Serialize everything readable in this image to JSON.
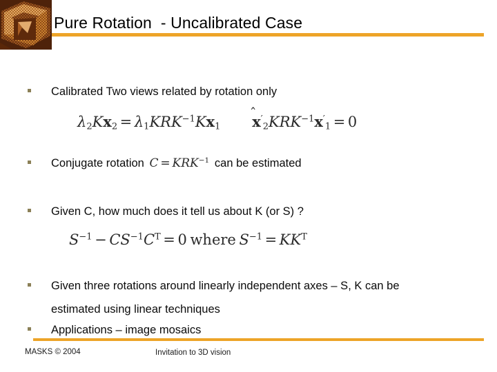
{
  "slide": {
    "title": "Pure Rotation  - Uncalibrated Case",
    "accent_color": "#eda428",
    "bullet_color": "#8b8057",
    "background_color": "#ffffff"
  },
  "logo": {
    "name": "masks-cube-logo",
    "colors": [
      "#7a3b12",
      "#c87a30",
      "#e8b273",
      "#5c2a0c",
      "#a85c20"
    ]
  },
  "bullets": [
    {
      "id": "b1",
      "text": "Calibrated Two views related by rotation only"
    },
    {
      "id": "b2",
      "text_before": "Conjugate rotation",
      "text_after": "can be estimated"
    },
    {
      "id": "b3",
      "text": "Given C, how much does it tell us about K (or S) ?"
    },
    {
      "id": "b4",
      "text": "Given three rotations around linearly independent  axes – S, K can be estimated using linear techniques"
    },
    {
      "id": "b5",
      "text": "Applications – image mosaics"
    }
  ],
  "equations": {
    "eq1": {
      "plain": "λ₂Kx₂ = λ₁KRK⁻¹Kx₁",
      "lambda2": "λ",
      "sub2": "2",
      "K": "K",
      "x": "x",
      "eq": "=",
      "lambda1": "λ",
      "sub1": "1",
      "R": "R",
      "minus_one": "−1"
    },
    "eq2": {
      "plain": "x̂′₂KRK⁻¹x′₁ = 0",
      "hat": "⁀",
      "x": "x",
      "prime": "′",
      "sub2": "2",
      "sub1": "1",
      "K": "K",
      "R": "R",
      "minus_one": "−1",
      "eq": "=",
      "zero": "0"
    },
    "eq3": {
      "plain": "S⁻¹ − CS⁻¹Cᵀ = 0 where S⁻¹ = KKᵀ",
      "S": "S",
      "C": "C",
      "K": "K",
      "minus_one": "−1",
      "T": "T",
      "minus": "−",
      "eq": "=",
      "zero": "0",
      "where": "where"
    },
    "eq_inline_C": {
      "plain": "C = KRK⁻¹",
      "C": "C",
      "eq": "=",
      "K": "K",
      "R": "R",
      "minus_one": "−1"
    }
  },
  "footer": {
    "left": "MASKS © 2004",
    "center": "Invitation to 3D vision"
  }
}
